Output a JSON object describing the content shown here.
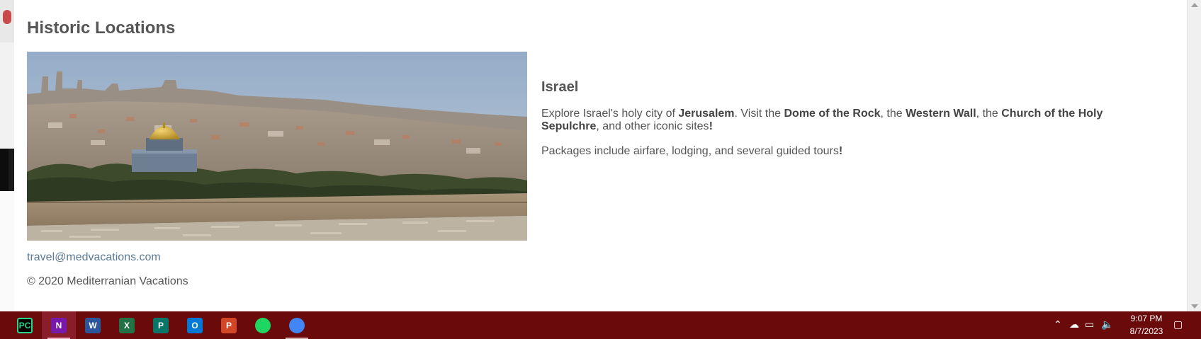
{
  "page": {
    "section_title": "Historic Locations",
    "hero_image_alt": "Jerusalem",
    "destination": {
      "title": "Israel",
      "desc_parts": [
        {
          "text": "Explore Israel's holy city of ",
          "bold": false
        },
        {
          "text": "Jerusalem",
          "bold": true
        },
        {
          "text": ". Visit the ",
          "bold": false
        },
        {
          "text": "Dome of the Rock",
          "bold": true
        },
        {
          "text": ", the ",
          "bold": false
        },
        {
          "text": "Western Wall",
          "bold": true
        },
        {
          "text": ", the ",
          "bold": false
        },
        {
          "text": "Church of the Holy Sepulchre",
          "bold": true
        },
        {
          "text": ", and other iconic sites",
          "bold": false
        },
        {
          "text": "!",
          "bold": true
        }
      ],
      "packages_text": "Packages include airfare, lodging, and several guided tours",
      "packages_exclaim": "!"
    },
    "footer": {
      "email": "travel@medvacations.com",
      "copyright": "© 2020 Mediterranian Vacations"
    }
  },
  "taskbar": {
    "apps": [
      {
        "name": "pycharm-icon",
        "label": "PC",
        "color": "#21d789",
        "state": "none"
      },
      {
        "name": "onenote-icon",
        "label": "N",
        "color": "#7719aa",
        "state": "active"
      },
      {
        "name": "word-icon",
        "label": "W",
        "color": "#2b579a",
        "state": "none"
      },
      {
        "name": "excel-icon",
        "label": "X",
        "color": "#217346",
        "state": "none"
      },
      {
        "name": "publisher-icon",
        "label": "P",
        "color": "#077568",
        "state": "none"
      },
      {
        "name": "outlook-icon",
        "label": "O",
        "color": "#0078d4",
        "state": "none"
      },
      {
        "name": "powerpoint-icon",
        "label": "P",
        "color": "#d24726",
        "state": "none"
      },
      {
        "name": "spotify-icon",
        "label": "",
        "color": "#1ed760",
        "state": "none"
      },
      {
        "name": "chrome-icon",
        "label": "",
        "color": "#4285f4",
        "state": "running"
      }
    ],
    "clock": {
      "time": "9:07 PM",
      "date": "8/7/2023"
    }
  }
}
